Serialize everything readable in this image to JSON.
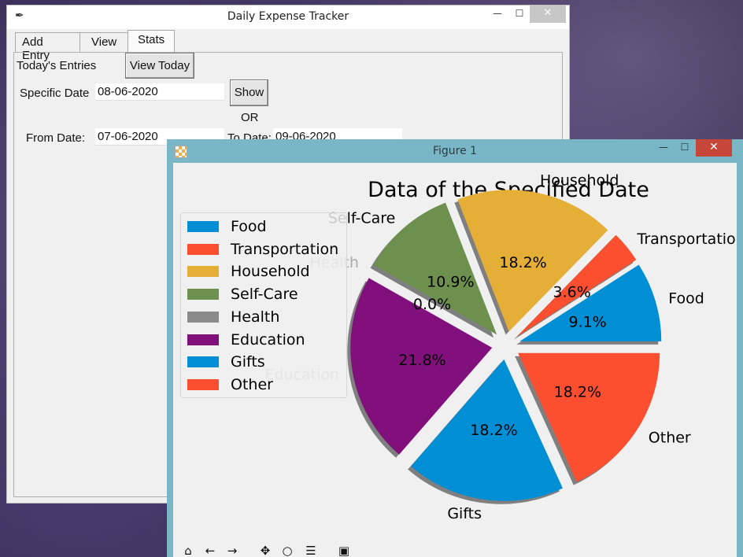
{
  "tracker": {
    "title": "Daily Expense Tracker",
    "tabs": [
      "Add Entry",
      "View",
      "Stats"
    ],
    "todays_label": "Today's Entries",
    "view_today_button": "View Today",
    "specific_date_label": "Specific Date",
    "specific_date_value": "08-06-2020",
    "show_button": "Show",
    "or_label": "OR",
    "from_date_label": "From Date:",
    "from_date_value": "07-06-2020",
    "to_date_label": "To Date:",
    "to_date_value": "09-06-2020"
  },
  "figure": {
    "title": "Figure 1",
    "toolbar_icons": [
      "home-icon",
      "back-icon",
      "forward-icon",
      "pan-icon",
      "zoom-icon",
      "configure-icon",
      "save-icon"
    ]
  },
  "chart_data": {
    "type": "pie",
    "title": "Data of the Specified Date",
    "labels": [
      "Food",
      "Transportation",
      "Household",
      "Self-Care",
      "Health",
      "Education",
      "Gifts",
      "Other"
    ],
    "values": [
      9.1,
      3.6,
      18.2,
      10.9,
      0.0,
      21.8,
      18.2,
      18.2
    ],
    "percent_labels": [
      "9.1%",
      "3.6%",
      "18.2%",
      "10.9%",
      "0.0%",
      "21.8%",
      "18.2%",
      "18.2%"
    ],
    "colors": [
      "#008fd5",
      "#fc4f30",
      "#e5ae37",
      "#6d904f",
      "#8b8b8b",
      "#810f7c",
      "#008fd5",
      "#fc4f30"
    ],
    "legend": "upper-left",
    "explode": true,
    "shadow": true
  }
}
